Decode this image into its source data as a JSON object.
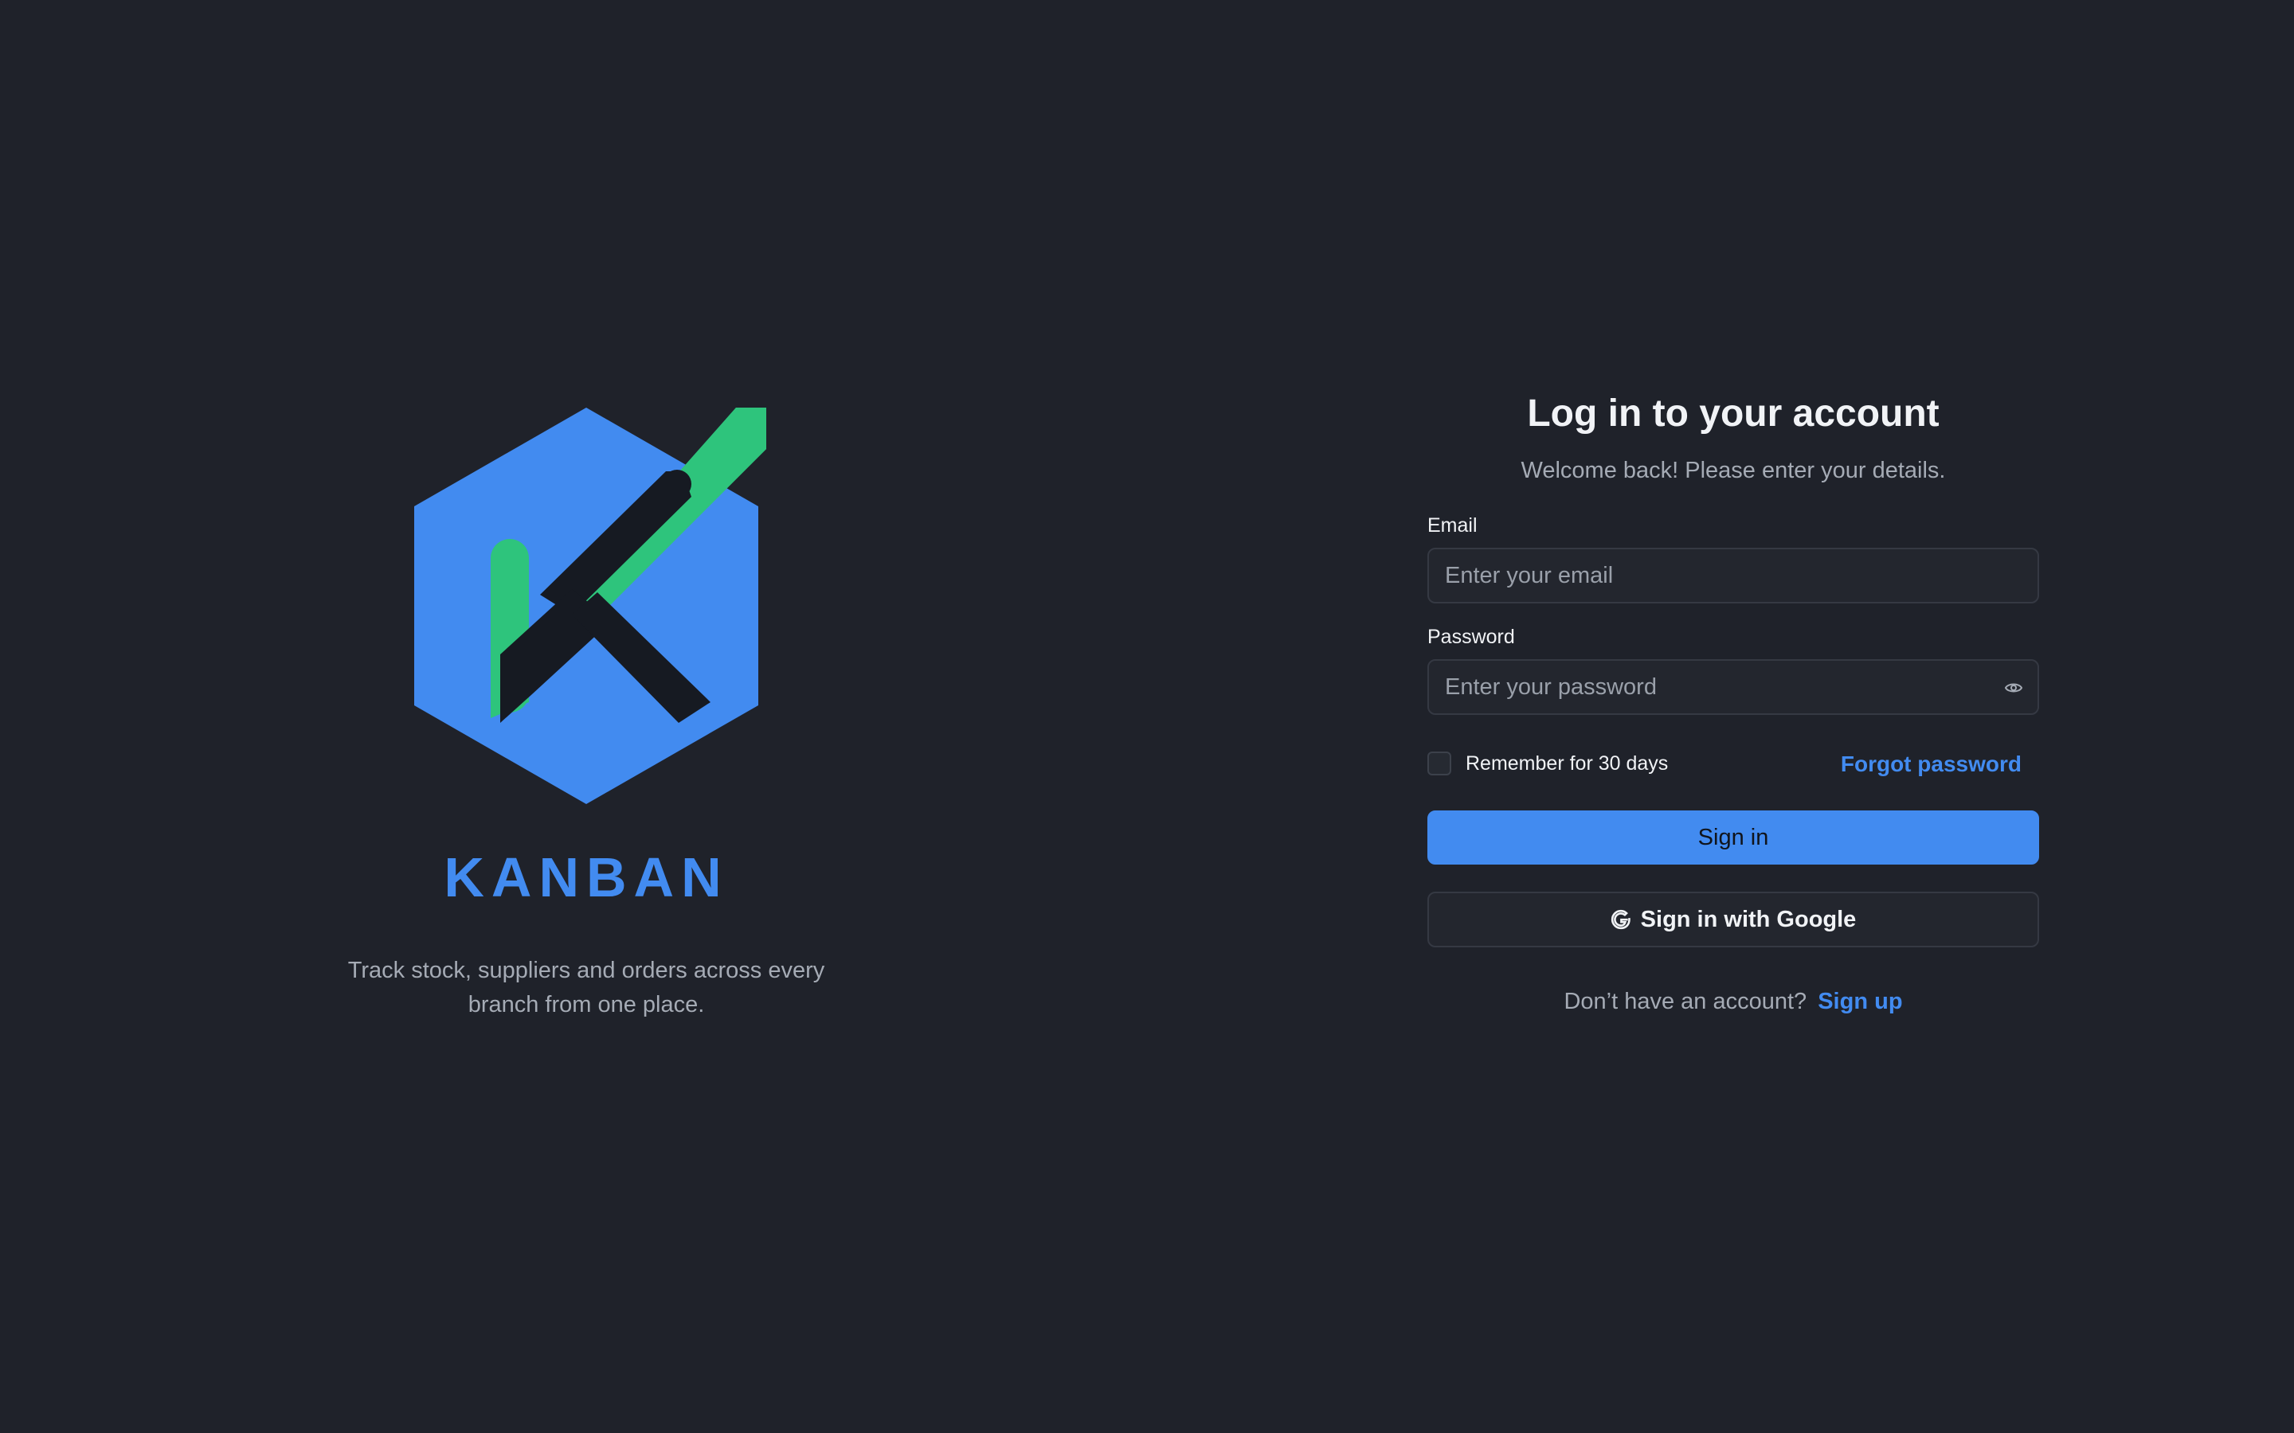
{
  "brand": {
    "name": "KANBAN",
    "tagline": "Track stock, suppliers and orders across every branch from one place."
  },
  "login": {
    "title": "Log in to your account",
    "subtitle": "Welcome back! Please enter your details.",
    "email": {
      "label": "Email",
      "placeholder": "Enter your email",
      "value": ""
    },
    "password": {
      "label": "Password",
      "placeholder": "Enter your password",
      "value": ""
    },
    "remember_label": "Remember for 30 days",
    "remember_checked": false,
    "forgot_label": "Forgot password",
    "sign_in_label": "Sign in",
    "google_label": "Sign in with Google",
    "signup_prompt": "Don’t have an account?",
    "signup_link": "Sign up"
  },
  "icons": {
    "password_toggle": "eye-icon",
    "google": "google-g-icon",
    "logo": "kanban-hexagon-logo"
  },
  "colors": {
    "background": "#1f222a",
    "accent": "#428bf0",
    "logo_green": "#2ec47c",
    "logo_dark": "#161a22"
  }
}
